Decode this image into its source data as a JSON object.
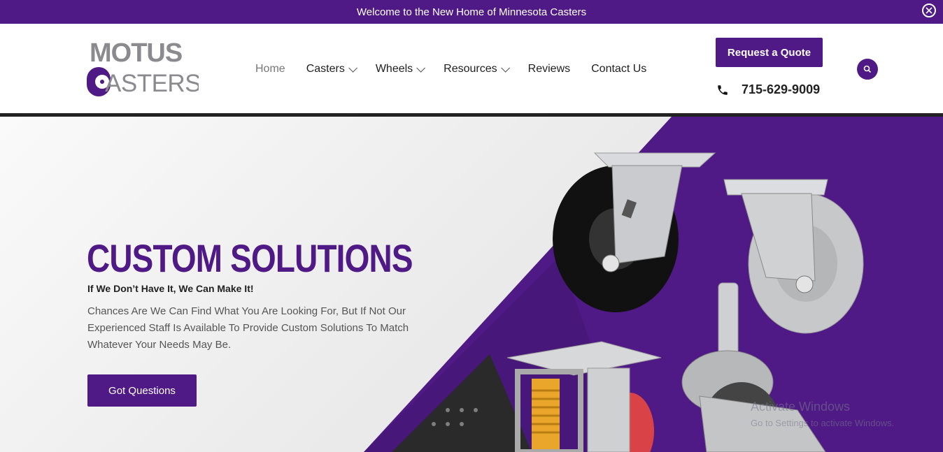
{
  "announcement": {
    "text": "Welcome to the New Home of Minnesota Casters",
    "close_icon": "close-circle-icon"
  },
  "logo": {
    "line1": "MOTUS",
    "line2": "ASTERS",
    "colors": {
      "gray": "#8a8a8f",
      "purple": "#4f1a85"
    }
  },
  "nav": {
    "items": [
      {
        "label": "Home",
        "active": true,
        "has_dropdown": false
      },
      {
        "label": "Casters",
        "active": false,
        "has_dropdown": true
      },
      {
        "label": "Wheels",
        "active": false,
        "has_dropdown": true
      },
      {
        "label": "Resources",
        "active": false,
        "has_dropdown": true
      },
      {
        "label": "Reviews",
        "active": false,
        "has_dropdown": false
      },
      {
        "label": "Contact Us",
        "active": false,
        "has_dropdown": false
      }
    ]
  },
  "header": {
    "quote_label": "Request a Quote",
    "phone": "715-629-9009",
    "phone_icon": "phone-icon",
    "search_icon": "search-icon"
  },
  "hero": {
    "title": "CUSTOM SOLUTIONS",
    "subtitle": "If We Don’t Have It, We Can Make It!",
    "body": "Chances Are We Can Find What You Are Looking For, But If Not Our Experienced Staff Is Available To Provide Custom Solutions To Match Whatever Your Needs May Be.",
    "button_label": "Got Questions"
  },
  "os_watermark": {
    "line1": "Activate Windows",
    "line2": "Go to Settings to activate Windows."
  },
  "colors": {
    "brand": "#4f1a85",
    "dark": "#222222"
  }
}
